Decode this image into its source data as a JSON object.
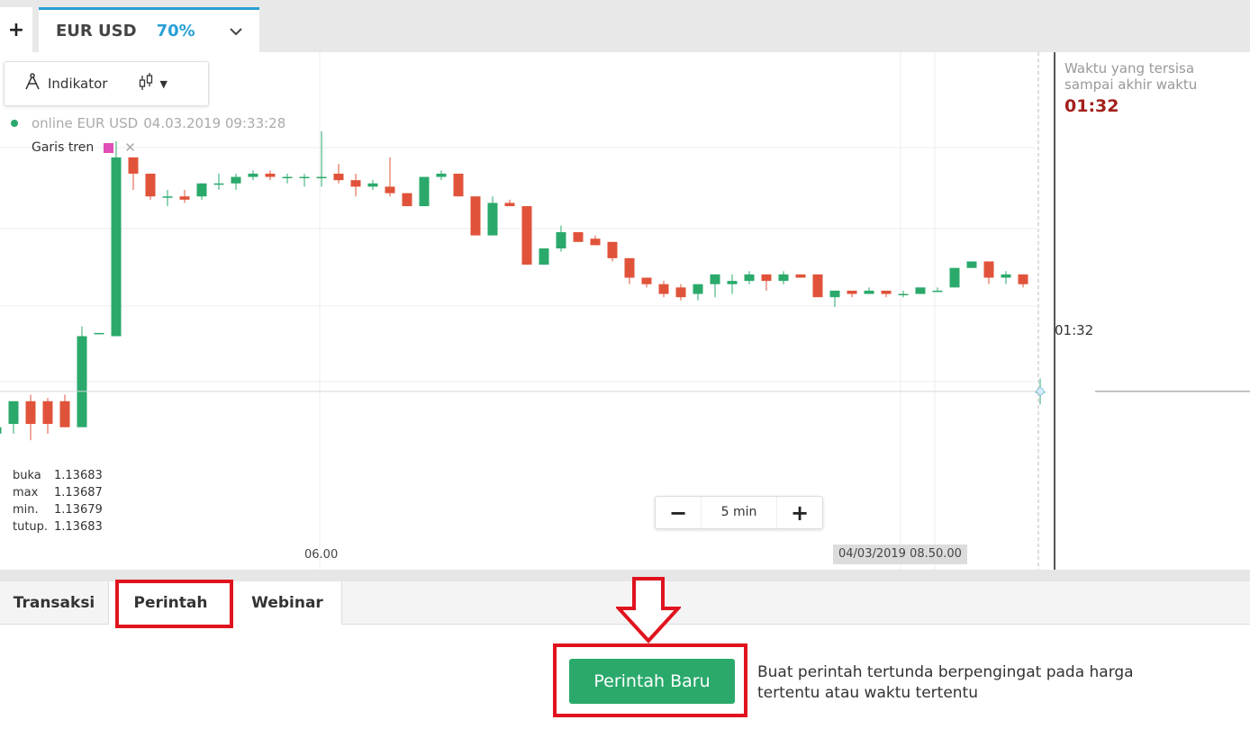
{
  "tabs": {
    "add_label": "+",
    "asset_name": "EUR USD",
    "asset_pct": "70%"
  },
  "toolbar": {
    "indicator_label": "Indikator"
  },
  "chart_header": {
    "online_text": "online EUR USD",
    "timestamp": "04.03.2019 09:33:28",
    "trend_label": "Garis tren",
    "trend_color": "#e04fb5"
  },
  "ohlc": [
    {
      "key": "buka",
      "value": "1.13683"
    },
    {
      "key": "max",
      "value": "1.13687"
    },
    {
      "key": "min.",
      "value": "1.13679"
    },
    {
      "key": "tutup.",
      "value": "1.13683"
    }
  ],
  "timer": {
    "line1": "Waktu yang tersisa",
    "line2": "sampai akhir waktu",
    "value": "01:32"
  },
  "price_tag": "01:32",
  "zoom": {
    "minus": "−",
    "label": "5 min",
    "plus": "+"
  },
  "x_labels": {
    "time": "06.00",
    "date": "04/03/2019 08.50.00"
  },
  "bottom_tabs": [
    "Transaksi",
    "Perintah",
    "Webinar"
  ],
  "new_order_label": "Perintah Baru",
  "description": "Buat perintah tertunda berpengingat pada harga tertentu atau waktu tertentu",
  "colors": {
    "up": "#2aa96b",
    "down": "#e0533a",
    "accent": "#2a9fd6",
    "highlight": "#e0141e"
  },
  "chart_data": {
    "type": "candlestick",
    "interval": "5 min",
    "x_tick_labels": [
      "06.00"
    ],
    "candles": [
      {
        "open": 1.1367,
        "high": 1.13675,
        "low": 1.1366,
        "close": 1.13672
      },
      {
        "open": 1.13673,
        "high": 1.13678,
        "low": 1.1367,
        "close": 1.1368
      },
      {
        "open": 1.1368,
        "high": 1.13682,
        "low": 1.13668,
        "close": 1.13673
      },
      {
        "open": 1.1368,
        "high": 1.13681,
        "low": 1.1367,
        "close": 1.13673
      },
      {
        "open": 1.1368,
        "high": 1.13682,
        "low": 1.13672,
        "close": 1.13672
      },
      {
        "open": 1.13672,
        "high": 1.13703,
        "low": 1.13672,
        "close": 1.137
      },
      {
        "open": 1.13701,
        "high": 1.13701,
        "low": 1.13701,
        "close": 1.13701
      },
      {
        "open": 1.137,
        "high": 1.1376,
        "low": 1.137,
        "close": 1.13755
      },
      {
        "open": 1.13755,
        "high": 1.13755,
        "low": 1.13745,
        "close": 1.1375
      },
      {
        "open": 1.1375,
        "high": 1.1375,
        "low": 1.13742,
        "close": 1.13743
      },
      {
        "open": 1.13743,
        "high": 1.13745,
        "low": 1.1374,
        "close": 1.13743
      },
      {
        "open": 1.13743,
        "high": 1.13745,
        "low": 1.13741,
        "close": 1.13742
      },
      {
        "open": 1.13743,
        "high": 1.13747,
        "low": 1.13742,
        "close": 1.13747
      },
      {
        "open": 1.13747,
        "high": 1.1375,
        "low": 1.13745,
        "close": 1.13747
      },
      {
        "open": 1.13747,
        "high": 1.1375,
        "low": 1.13745,
        "close": 1.13749
      },
      {
        "open": 1.13749,
        "high": 1.13751,
        "low": 1.13748,
        "close": 1.1375
      },
      {
        "open": 1.1375,
        "high": 1.13751,
        "low": 1.13748,
        "close": 1.13749
      },
      {
        "open": 1.13749,
        "high": 1.1375,
        "low": 1.13747,
        "close": 1.13749
      },
      {
        "open": 1.13749,
        "high": 1.1375,
        "low": 1.13746,
        "close": 1.13749
      },
      {
        "open": 1.13749,
        "high": 1.13763,
        "low": 1.13746,
        "close": 1.13749
      },
      {
        "open": 1.1375,
        "high": 1.13753,
        "low": 1.13747,
        "close": 1.13748
      },
      {
        "open": 1.13748,
        "high": 1.1375,
        "low": 1.13743,
        "close": 1.13746
      },
      {
        "open": 1.13746,
        "high": 1.13748,
        "low": 1.13745,
        "close": 1.13747
      },
      {
        "open": 1.13746,
        "high": 1.13755,
        "low": 1.13743,
        "close": 1.13744
      },
      {
        "open": 1.13744,
        "high": 1.13744,
        "low": 1.1374,
        "close": 1.1374
      },
      {
        "open": 1.1374,
        "high": 1.13749,
        "low": 1.1374,
        "close": 1.13749
      },
      {
        "open": 1.13749,
        "high": 1.13751,
        "low": 1.13748,
        "close": 1.1375
      },
      {
        "open": 1.1375,
        "high": 1.1375,
        "low": 1.13743,
        "close": 1.13743
      },
      {
        "open": 1.13743,
        "high": 1.13743,
        "low": 1.13731,
        "close": 1.13731
      },
      {
        "open": 1.13731,
        "high": 1.13743,
        "low": 1.13731,
        "close": 1.13741
      },
      {
        "open": 1.13741,
        "high": 1.13742,
        "low": 1.1374,
        "close": 1.1374
      },
      {
        "open": 1.1374,
        "high": 1.1374,
        "low": 1.13722,
        "close": 1.13722
      },
      {
        "open": 1.13722,
        "high": 1.13727,
        "low": 1.13722,
        "close": 1.13727
      },
      {
        "open": 1.13727,
        "high": 1.13734,
        "low": 1.13726,
        "close": 1.13732
      },
      {
        "open": 1.13732,
        "high": 1.13732,
        "low": 1.13729,
        "close": 1.13729
      },
      {
        "open": 1.1373,
        "high": 1.13731,
        "low": 1.13728,
        "close": 1.13728
      },
      {
        "open": 1.13729,
        "high": 1.13729,
        "low": 1.13723,
        "close": 1.13724
      },
      {
        "open": 1.13724,
        "high": 1.13724,
        "low": 1.13716,
        "close": 1.13718
      },
      {
        "open": 1.13718,
        "high": 1.13718,
        "low": 1.13715,
        "close": 1.13716
      },
      {
        "open": 1.13716,
        "high": 1.13717,
        "low": 1.13712,
        "close": 1.13713
      },
      {
        "open": 1.13715,
        "high": 1.13716,
        "low": 1.13711,
        "close": 1.13712
      },
      {
        "open": 1.13713,
        "high": 1.13716,
        "low": 1.13711,
        "close": 1.13716
      },
      {
        "open": 1.13716,
        "high": 1.13717,
        "low": 1.13712,
        "close": 1.13719
      },
      {
        "open": 1.13716,
        "high": 1.13719,
        "low": 1.13713,
        "close": 1.13717
      },
      {
        "open": 1.13717,
        "high": 1.1372,
        "low": 1.13716,
        "close": 1.13719
      },
      {
        "open": 1.13719,
        "high": 1.13719,
        "low": 1.13714,
        "close": 1.13717
      },
      {
        "open": 1.13717,
        "high": 1.1372,
        "low": 1.13716,
        "close": 1.13719
      },
      {
        "open": 1.13719,
        "high": 1.13719,
        "low": 1.13718,
        "close": 1.13718
      },
      {
        "open": 1.13719,
        "high": 1.13719,
        "low": 1.13712,
        "close": 1.13712
      },
      {
        "open": 1.13712,
        "high": 1.13714,
        "low": 1.13709,
        "close": 1.13714
      },
      {
        "open": 1.13714,
        "high": 1.13714,
        "low": 1.13712,
        "close": 1.13713
      },
      {
        "open": 1.13713,
        "high": 1.13715,
        "low": 1.13713,
        "close": 1.13714
      },
      {
        "open": 1.13714,
        "high": 1.13714,
        "low": 1.13712,
        "close": 1.13713
      },
      {
        "open": 1.13713,
        "high": 1.13714,
        "low": 1.13712,
        "close": 1.13713
      },
      {
        "open": 1.13713,
        "high": 1.13715,
        "low": 1.13713,
        "close": 1.13715
      },
      {
        "open": 1.13714,
        "high": 1.13715,
        "low": 1.13714,
        "close": 1.13714
      },
      {
        "open": 1.13715,
        "high": 1.13721,
        "low": 1.13715,
        "close": 1.13721
      },
      {
        "open": 1.13721,
        "high": 1.13723,
        "low": 1.13721,
        "close": 1.13723
      },
      {
        "open": 1.13723,
        "high": 1.13723,
        "low": 1.13716,
        "close": 1.13718
      },
      {
        "open": 1.13718,
        "high": 1.1372,
        "low": 1.13716,
        "close": 1.13719
      },
      {
        "open": 1.13719,
        "high": 1.13719,
        "low": 1.13715,
        "close": 1.13716
      },
      {
        "open": 1.13683,
        "high": 1.13687,
        "low": 1.13679,
        "close": 1.13683
      }
    ]
  }
}
